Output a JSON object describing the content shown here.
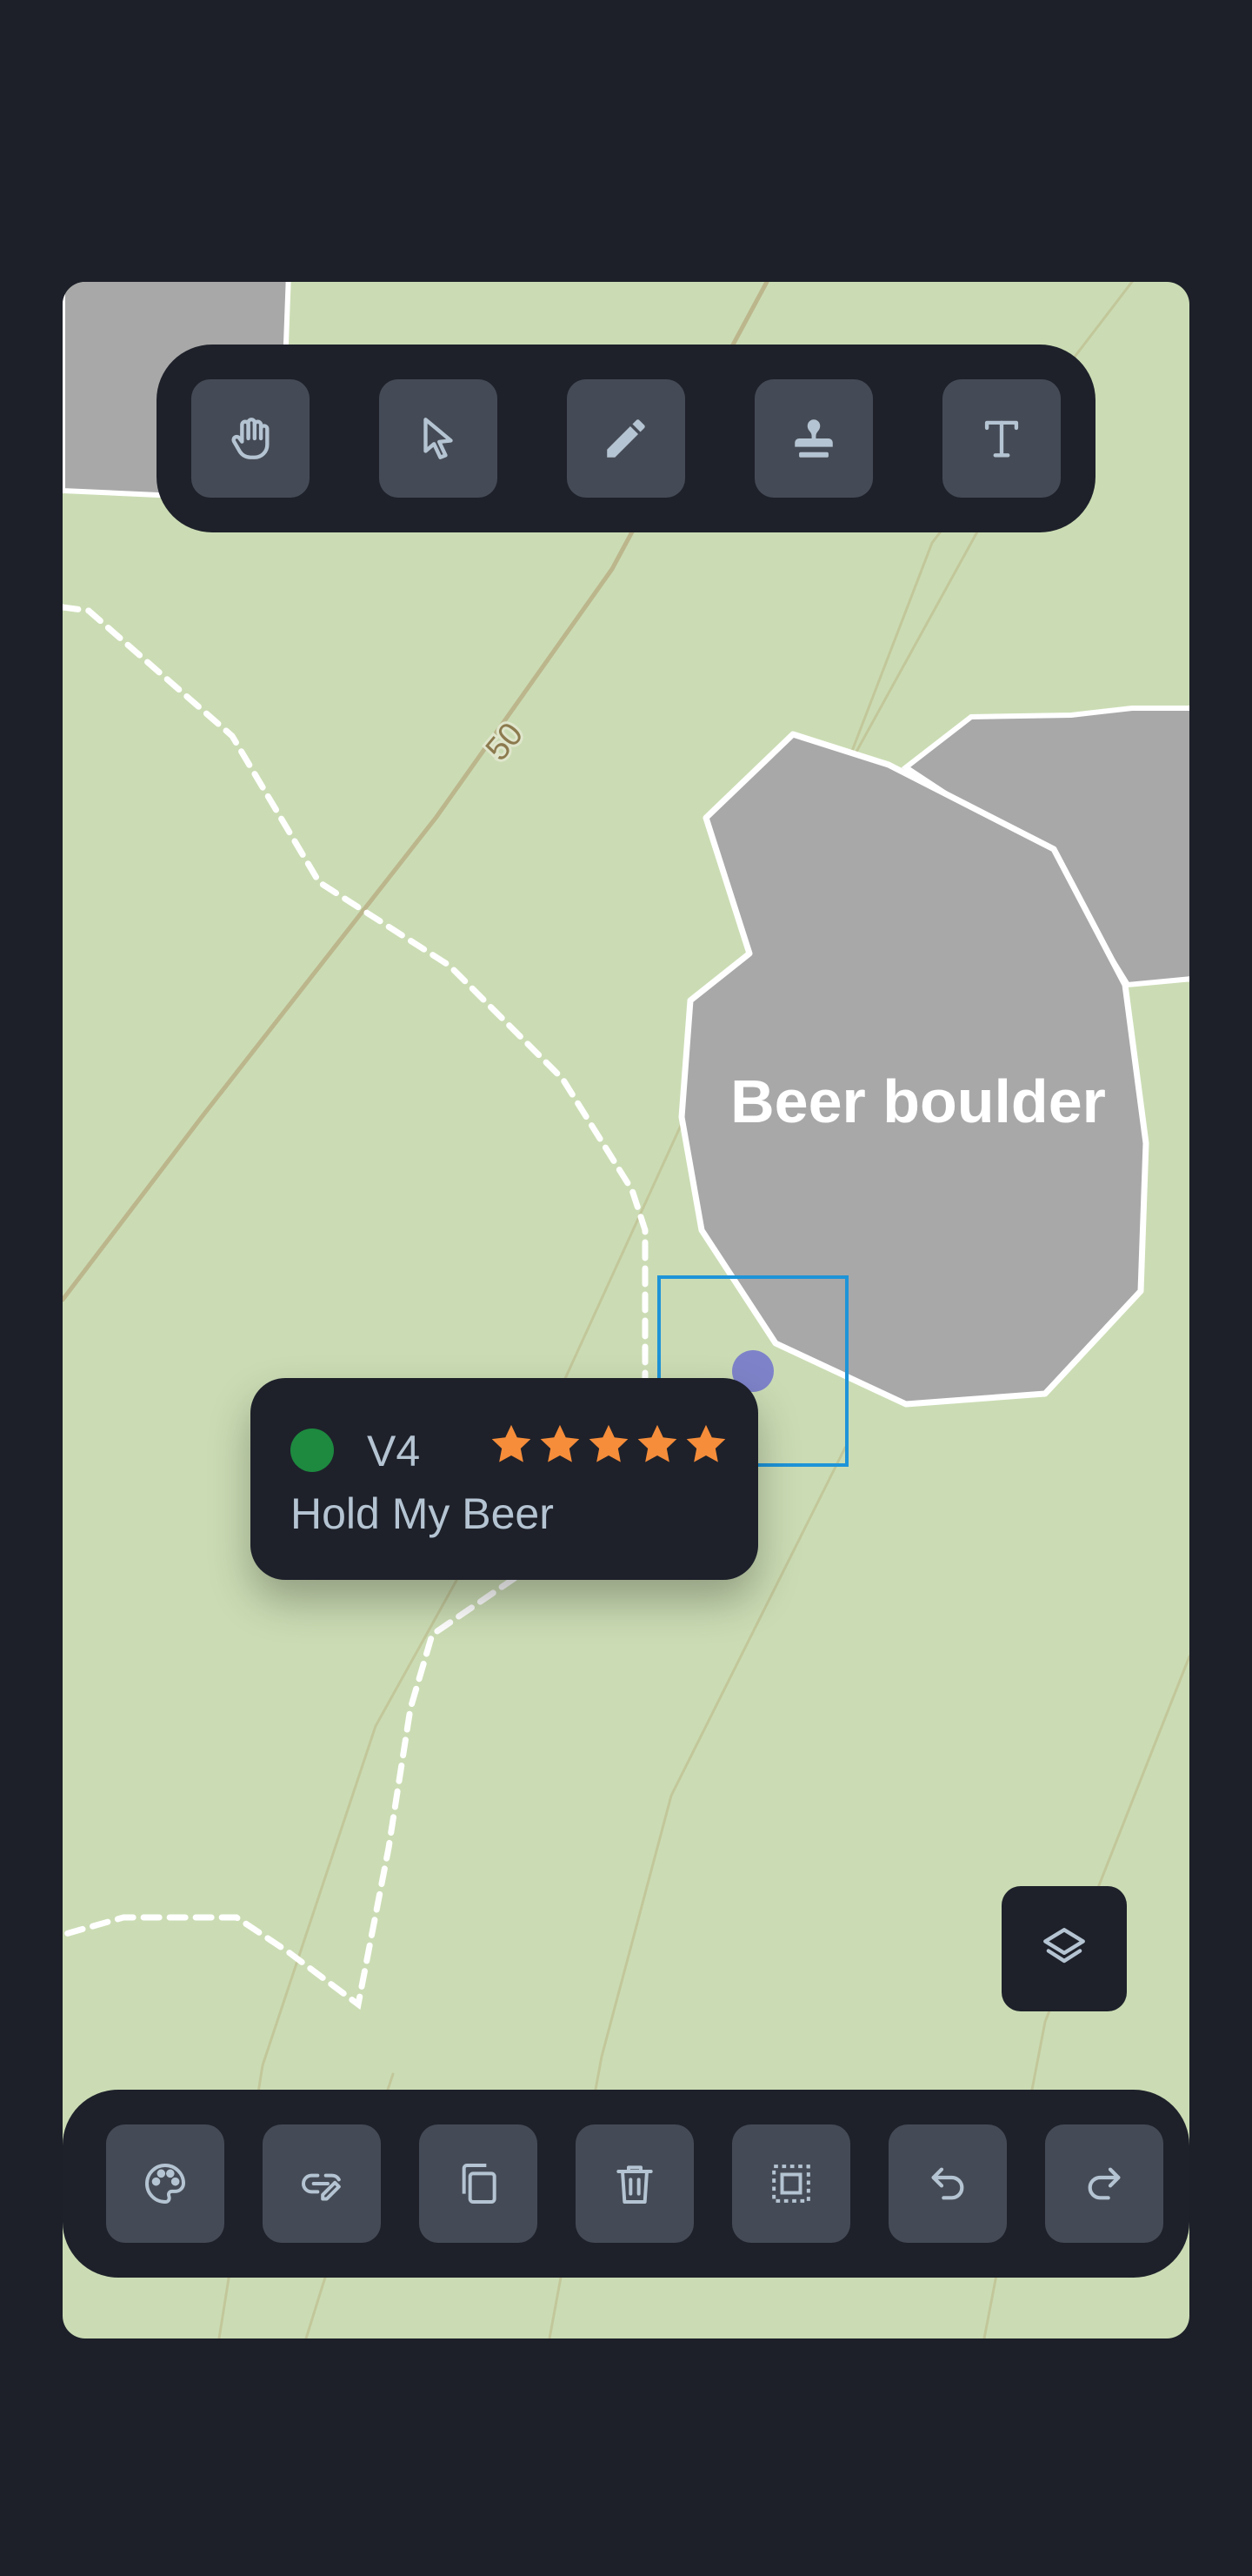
{
  "map": {
    "contour_label": "50",
    "boulder_label": "Beer boulder",
    "colors": {
      "background": "#cbdcb4",
      "boulder_fill": "#a8a8a8",
      "contour": "#b9b58c",
      "selection": "#1e94d8",
      "marker": "#7e83c9"
    }
  },
  "top_toolbar": {
    "tools": [
      {
        "icon": "hand-icon",
        "label": "Pan"
      },
      {
        "icon": "pointer-icon",
        "label": "Select"
      },
      {
        "icon": "pencil-icon",
        "label": "Draw"
      },
      {
        "icon": "stamp-icon",
        "label": "Stamp"
      },
      {
        "icon": "text-icon",
        "label": "Text"
      }
    ]
  },
  "route_card": {
    "grade": "V4",
    "grade_color": "#1d8a3f",
    "stars": 5,
    "star_color": "#f68d3a",
    "name": "Hold My Beer"
  },
  "layers_button": {
    "icon": "layers-icon"
  },
  "bottom_toolbar": {
    "actions": [
      {
        "icon": "palette-icon"
      },
      {
        "icon": "link-edit-icon"
      },
      {
        "icon": "copy-icon"
      },
      {
        "icon": "trash-icon"
      },
      {
        "icon": "select-frame-icon"
      },
      {
        "icon": "undo-icon"
      },
      {
        "icon": "redo-icon"
      }
    ]
  }
}
